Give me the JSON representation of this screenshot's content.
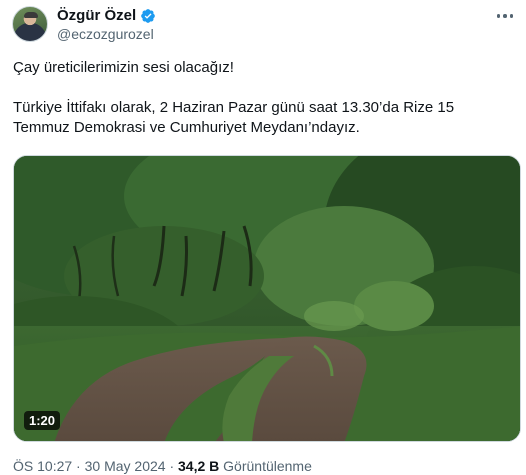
{
  "author": {
    "name": "Özgür Özel",
    "handle": "@eczozgurozel",
    "verified": true
  },
  "tweet": {
    "line1": "Çay üreticilerimizin sesi olacağız!",
    "line2": "Türkiye İttifakı olarak, 2 Haziran Pazar günü saat 13.30’da Rize 15",
    "line3": "Temmuz Demokrasi ve Cumhuriyet Meydanı’ndayız."
  },
  "media": {
    "type": "video",
    "duration": "1:20"
  },
  "meta": {
    "time": "ÖS 10:27",
    "separator1": " · ",
    "date": "30 May 2024",
    "separator2": " · ",
    "views_count": "34,2 B",
    "views_label": " Görüntülenme"
  },
  "colors": {
    "text": "#0f1419",
    "secondary": "#536471",
    "verified": "#1d9bf0"
  },
  "icons": {
    "verified": "verified-badge-icon",
    "more": "more-options-icon"
  }
}
